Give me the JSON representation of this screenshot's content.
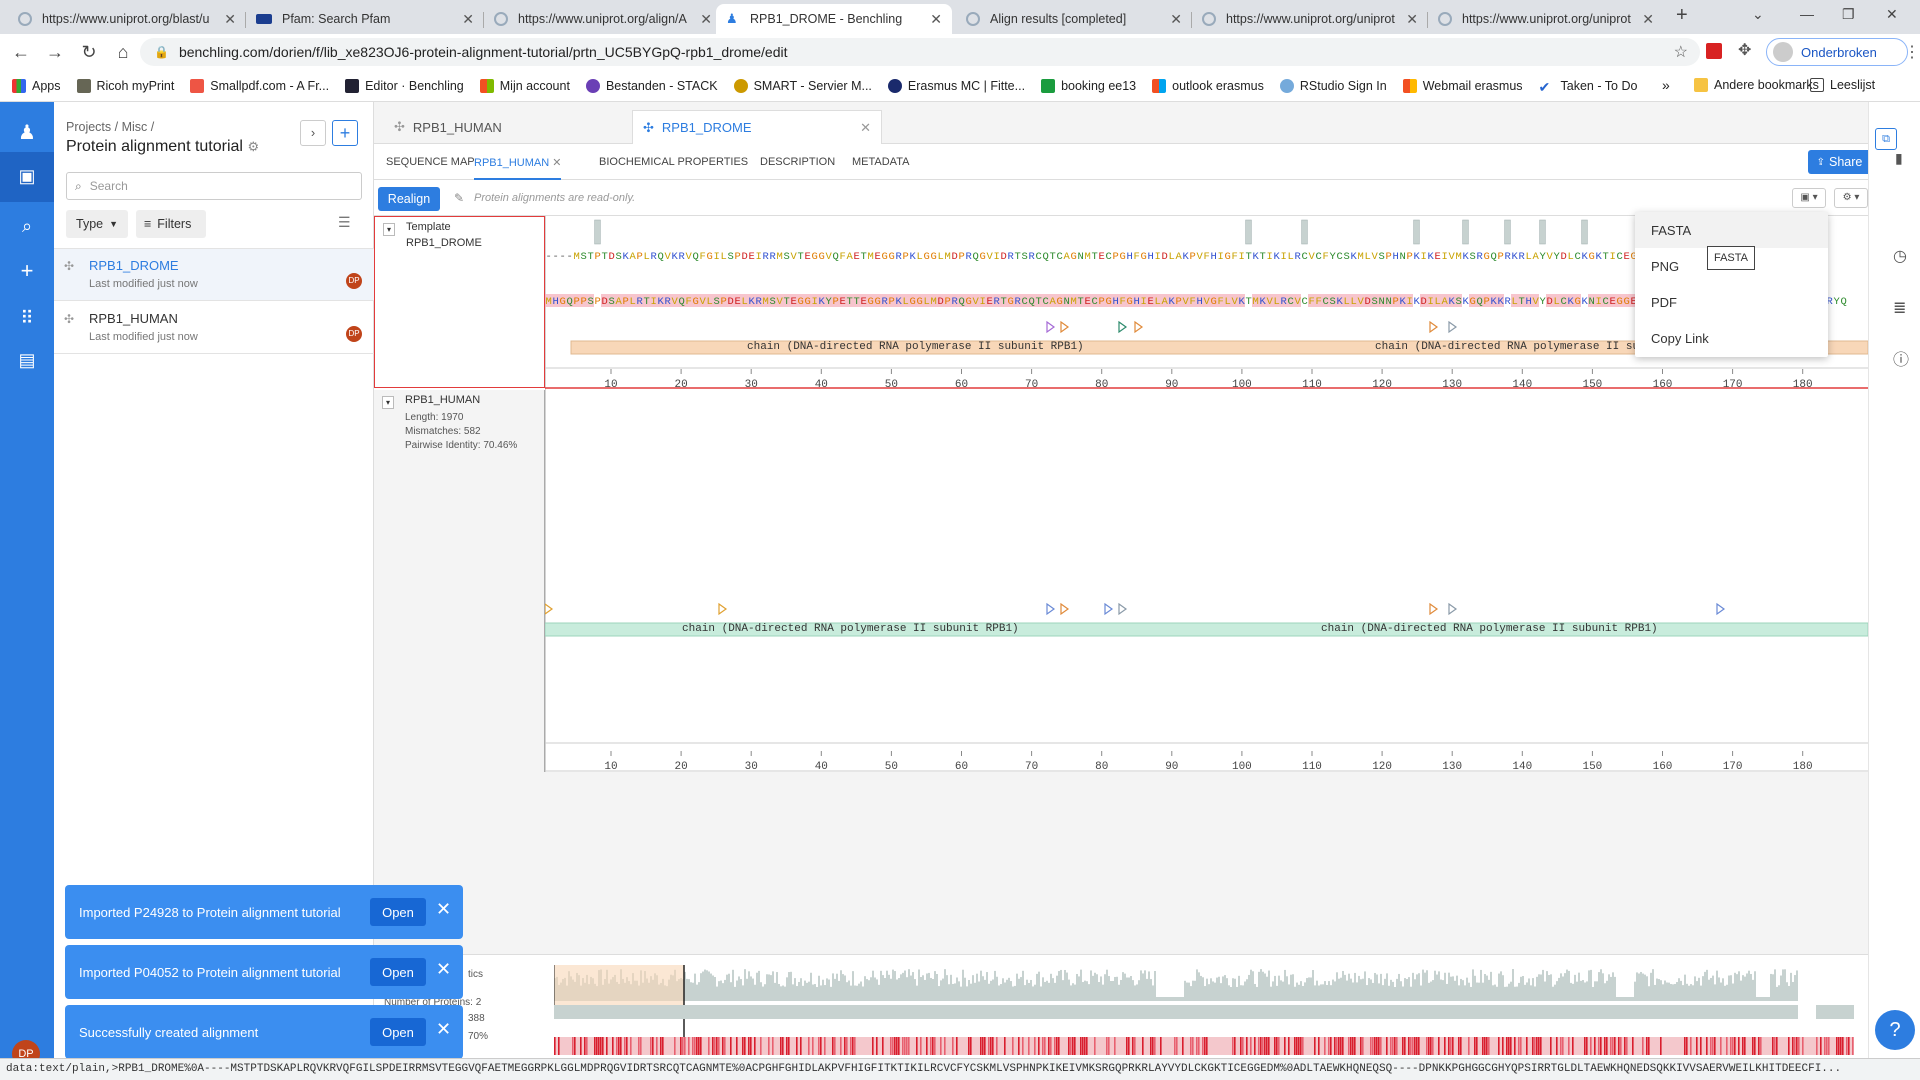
{
  "browser": {
    "tabs": [
      {
        "title": "https://www.uniprot.org/blast/u",
        "active": false
      },
      {
        "title": "Pfam: Search Pfam",
        "active": false
      },
      {
        "title": "https://www.uniprot.org/align/A",
        "active": false
      },
      {
        "title": "RPB1_DROME - Benchling",
        "active": true
      },
      {
        "title": "Align results [completed]",
        "active": false
      },
      {
        "title": "https://www.uniprot.org/uniprot",
        "active": false
      },
      {
        "title": "https://www.uniprot.org/uniprot",
        "active": false
      }
    ],
    "new_tab": "+",
    "url": "benchling.com/dorien/f/lib_xe823OJ6-protein-alignment-tutorial/prtn_UC5BYGpQ-rpb1_drome/edit",
    "profile_label": "Onderbroken",
    "bookmarks": [
      "Apps",
      "Ricoh myPrint",
      "Smallpdf.com - A Fr...",
      "Editor · Benchling",
      "Mijn account",
      "Bestanden - STACK",
      "SMART - Servier M...",
      "Erasmus MC | Fitte...",
      "booking ee13",
      "outlook erasmus",
      "RStudio Sign In",
      "Webmail erasmus",
      "Taken - To Do"
    ],
    "bookmarks_more": "»",
    "other_bookmarks": "Andere bookmarks",
    "reading_list": "Leeslijst",
    "status_url": "data:text/plain,>RPB1_DROME%0A----MSTPTDSKAPLRQVKRVQFGILSPDEIRRMSVTEGGVQFAETMEGGRPKLGGLMDPRQGVIDRTSRCQTCAGNMTE%0ACPGHFGHIDLAKPVFHIGFITKTIKILRCVCFYCSKMLVSPHNPKIKEIVMKSRGQPRKRLAYVYDLCKGKTICEGGEDM%0ADLTAEWKHQNEQSQ----DPNKKPGHGGCGHYQPSIRRTGLDLTAEWKHQNEDSQKKIVVSAERVWEILKHITDEECFI..."
  },
  "sidebar": {
    "breadcrumb": "Projects / Misc /",
    "title": "Protein alignment tutorial",
    "search_placeholder": "Search",
    "type_label": "Type",
    "filters_label": "Filters",
    "items": [
      {
        "name": "RPB1_DROME",
        "meta": "Last modified just now",
        "avatar": "DP",
        "selected": true
      },
      {
        "name": "RPB1_HUMAN",
        "meta": "Last modified just now",
        "avatar": "DP",
        "selected": false
      }
    ],
    "user_avatar": "DP"
  },
  "doc_tabs": [
    {
      "label": "RPB1_HUMAN",
      "active": false
    },
    {
      "label": "RPB1_DROME",
      "active": true
    }
  ],
  "subtabs": [
    "SEQUENCE MAP",
    "RPB1_HUMAN",
    "BIOCHEMICAL PROPERTIES",
    "DESCRIPTION",
    "METADATA"
  ],
  "active_subtab": 1,
  "share_label": "Share",
  "realign_label": "Realign",
  "readonly_note": "Protein alignments are read-only.",
  "template": {
    "header": "Template",
    "name": "RPB1_DROME",
    "sequence": "----MSTPTDSKAPLRQVKRVQFGILSPDEIRRMSVTEGGVQFAETMEGGRPKLGGLMDPRQGVIDRTSRCQTCAGNMTECPGHFGHIDLAKPVFHIGFITKTIKILRCVCFYCSKMLVSPHNPKIKEIVMKSRGQPRKRLAYVYDLCKGKTICEGGEDMDLTAEWKHQNEGHYQ",
    "annotation": "chain (DNA-directed RNA polymerase II subunit RPB1)",
    "annotation2": "chain (DNA-directed RNA polymerase II subunit"
  },
  "aligned": {
    "name": "RPB1_HUMAN",
    "length": "Length: 1970",
    "mismatches": "Mismatches: 582",
    "identity": "Pairwise Identity: 70.46%",
    "sequence": "MHGQPPSPDSAPLRTIKRVQFGVLSPDELKRMSVTEGGIKYPETTEGGRPKLGGLMDPRQGVIERTGRCQTCAGNMTECPGHFGHIELAKPVFHVGFLVKTMKVLRCVCFFCSKLLVDSNNPKIKDILAKSKGQPKKRLTHVYDLCKGKNICEGGEEMDNKFGVEQPEGDEDLTKEKGHGGCGRYQ",
    "annotation": "chain (DNA-directed RNA polymerase II subunit RPB1)"
  },
  "ruler_ticks": [
    "10",
    "20",
    "30",
    "40",
    "50",
    "60",
    "70",
    "80",
    "90",
    "100",
    "110",
    "120",
    "130",
    "140",
    "150",
    "160",
    "170",
    "180"
  ],
  "export_menu": {
    "items": [
      "FASTA",
      "PNG",
      "PDF",
      "Copy Link"
    ],
    "tooltip": "FASTA"
  },
  "overview": {
    "label_partial": "tics",
    "proteins_partial": "Number of Proteins: 2",
    "length_partial": "388",
    "identity_partial": "70%"
  },
  "toasts": [
    {
      "text": "Imported P24928 to Protein alignment tutorial",
      "button": "Open"
    },
    {
      "text": "Imported P04052 to Protein alignment tutorial",
      "button": "Open"
    },
    {
      "text": "Successfully created alignment",
      "button": "Open"
    }
  ],
  "help_label": "?",
  "colors": {
    "accent": "#2d7de0",
    "chain_template": "#f8d7b8",
    "chain_aligned": "#c8ecdc",
    "selection_border": "#e23b3b"
  }
}
